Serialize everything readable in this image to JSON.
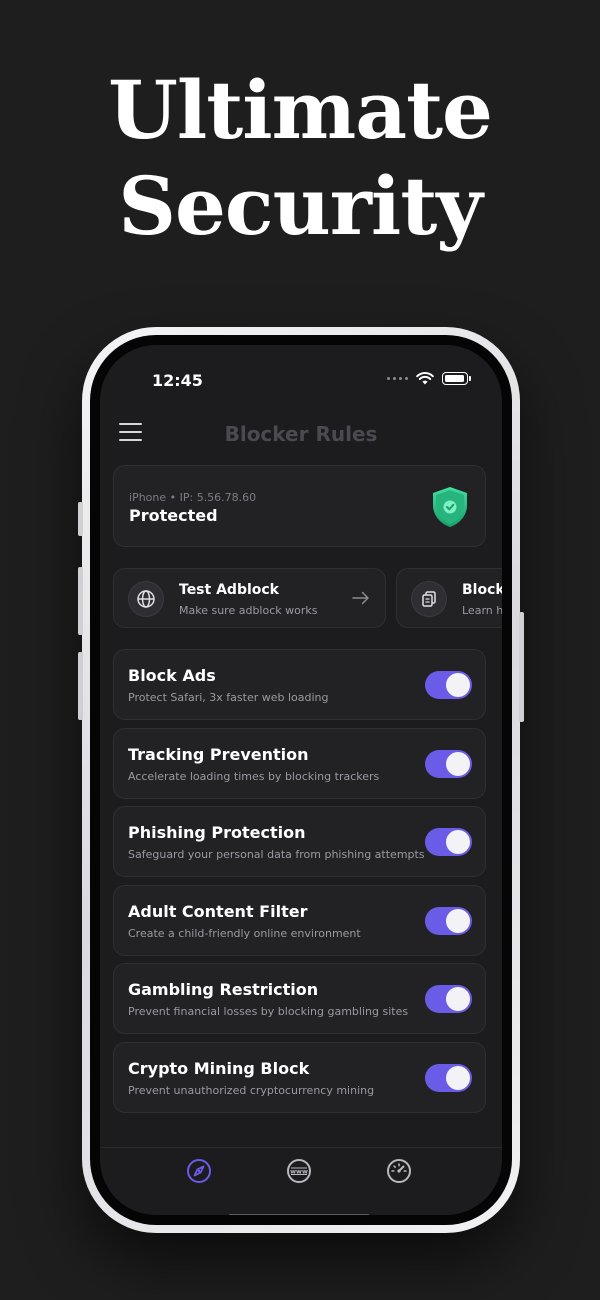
{
  "headline": {
    "line1": "Ultimate",
    "line2": "Security"
  },
  "status_bar": {
    "time": "12:45"
  },
  "nav": {
    "title": "Blocker Rules"
  },
  "status_card": {
    "device_info": "iPhone • IP: 5.56.78.60",
    "status": "Protected"
  },
  "quick_actions": [
    {
      "title": "Test Adblock",
      "subtitle": "Make sure adblock works"
    },
    {
      "title": "Block",
      "subtitle": "Learn h"
    }
  ],
  "rules": [
    {
      "title": "Block Ads",
      "subtitle": "Protect Safari, 3x faster web loading",
      "enabled": true
    },
    {
      "title": "Tracking Prevention",
      "subtitle": "Accelerate loading times by blocking trackers",
      "enabled": true
    },
    {
      "title": "Phishing Protection",
      "subtitle": "Safeguard your personal data from phishing attempts",
      "enabled": true
    },
    {
      "title": "Adult Content Filter",
      "subtitle": "Create a child-friendly online environment",
      "enabled": true
    },
    {
      "title": "Gambling Restriction",
      "subtitle": "Prevent financial losses by blocking gambling sites",
      "enabled": true
    },
    {
      "title": "Crypto Mining Block",
      "subtitle": "Prevent unauthorized cryptocurrency mining",
      "enabled": true
    }
  ],
  "tabs": [
    {
      "icon": "compass-icon",
      "active": true
    },
    {
      "icon": "www-globe-icon",
      "active": false
    },
    {
      "icon": "speedometer-icon",
      "active": false
    }
  ],
  "colors": {
    "accent": "#6b5ce7",
    "shield": "#2ec98a",
    "background": "#1e1e1f",
    "card": "#222225"
  }
}
